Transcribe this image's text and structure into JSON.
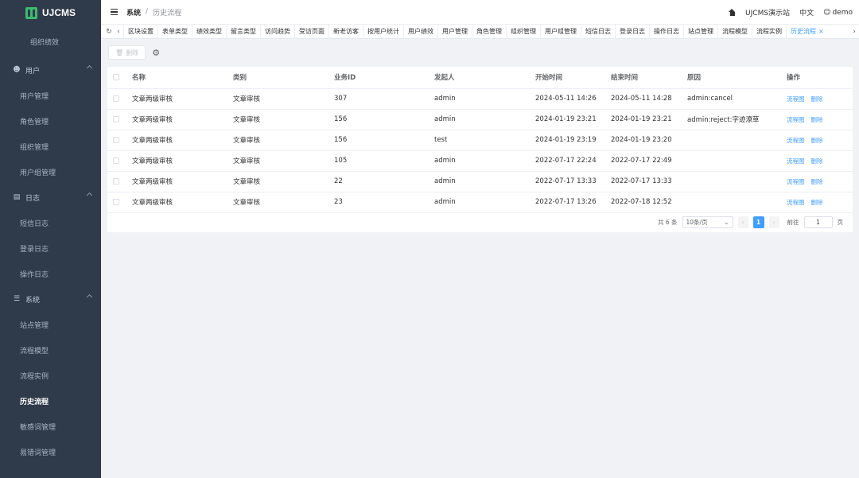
{
  "app": {
    "logo_text": "UJCMS"
  },
  "sidebar": {
    "top_item": "组织绩效",
    "groups": [
      {
        "label": "用户",
        "icon": "user-icon",
        "items": [
          "用户管理",
          "角色管理",
          "组织管理",
          "用户组管理"
        ]
      },
      {
        "label": "日志",
        "icon": "log-icon",
        "items": [
          "短信日志",
          "登录日志",
          "操作日志"
        ]
      },
      {
        "label": "系统",
        "icon": "settings-icon",
        "items": [
          "站点管理",
          "流程模型",
          "流程实例",
          "历史流程",
          "敏感词管理",
          "易错词管理"
        ]
      }
    ],
    "active_item": "历史流程"
  },
  "header": {
    "breadcrumb_root": "系统",
    "breadcrumb_sep": "/",
    "breadcrumb_current": "历史流程",
    "site_name": "UJCMS演示站",
    "language": "中文",
    "username": "demo"
  },
  "tabs": {
    "items": [
      "区块设置",
      "表单类型",
      "绩效类型",
      "留言类型",
      "访问趋势",
      "受访页面",
      "新老访客",
      "按用户统计",
      "用户绩效",
      "用户管理",
      "角色管理",
      "组织管理",
      "用户组管理",
      "短信日志",
      "登录日志",
      "操作日志",
      "站点管理",
      "流程模型",
      "流程实例",
      "历史流程"
    ],
    "active": "历史流程"
  },
  "toolbar": {
    "delete_label": "删除"
  },
  "table": {
    "columns": [
      "名称",
      "类别",
      "业务ID",
      "发起人",
      "开始时间",
      "结束时间",
      "原因",
      "操作"
    ],
    "rows": [
      [
        "文章两级审核",
        "文章审核",
        "307",
        "admin",
        "2024-05-11 14:26",
        "2024-05-11 14:28",
        "admin:cancel"
      ],
      [
        "文章两级审核",
        "文章审核",
        "156",
        "admin",
        "2024-01-19 23:21",
        "2024-01-19 23:21",
        "admin:reject:字迹潦草"
      ],
      [
        "文章两级审核",
        "文章审核",
        "156",
        "test",
        "2024-01-19 23:19",
        "2024-01-19 23:20",
        ""
      ],
      [
        "文章两级审核",
        "文章审核",
        "105",
        "admin",
        "2022-07-17 22:24",
        "2022-07-17 22:49",
        ""
      ],
      [
        "文章两级审核",
        "文章审核",
        "22",
        "admin",
        "2022-07-17 13:33",
        "2022-07-17 13:33",
        ""
      ],
      [
        "文章两级审核",
        "文章审核",
        "23",
        "admin",
        "2022-07-17 13:26",
        "2022-07-18 12:52",
        ""
      ]
    ],
    "op_flowchart": "流程图",
    "op_delete": "删除"
  },
  "pagination": {
    "total_text": "共 6 条",
    "page_size": "10条/页",
    "current_page": "1",
    "goto_label": "前往",
    "goto_value": "1",
    "page_unit": "页"
  }
}
